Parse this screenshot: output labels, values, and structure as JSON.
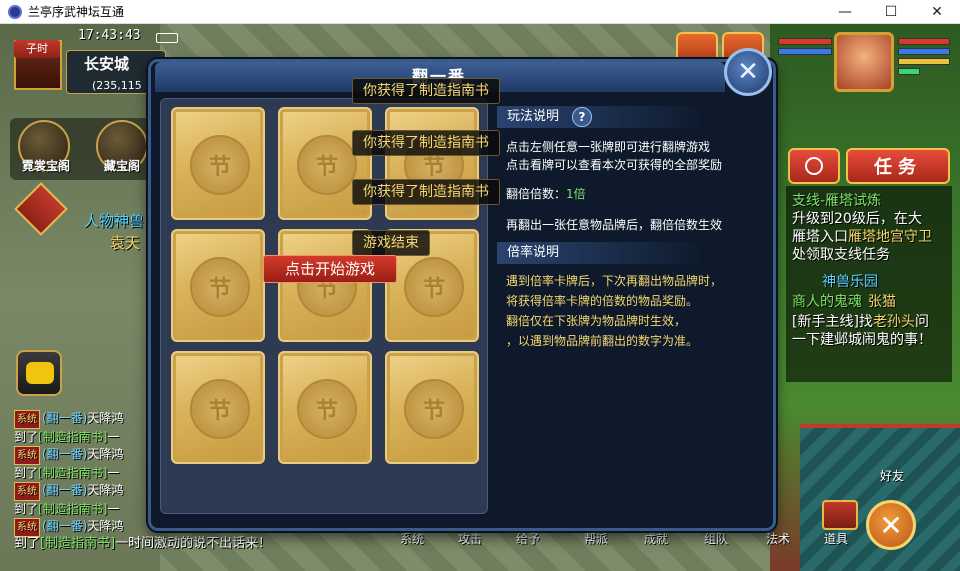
{
  "window": {
    "title": "兰亭序武神坛互通"
  },
  "hud": {
    "time_period": "子时",
    "clock": "17:43:43",
    "city": "长安城",
    "coords": "(235,115",
    "left_buttons": [
      "霓裳宝阁",
      "藏宝阁"
    ],
    "npc_name": "人物神兽",
    "npc_sub": "袁天"
  },
  "dialog": {
    "title": "翻一番",
    "card_glyph": "节",
    "start_button": "点击开始游戏",
    "popups": [
      "你获得了制造指南书",
      "你获得了制造指南书",
      "你获得了制造指南书",
      "游戏结束"
    ],
    "rules_header": "玩法说明",
    "help_mark": "?",
    "rules_lines": [
      "点击左侧任意一张牌即可进行翻牌游戏",
      "点击看牌可以查看本次可获得的全部奖励"
    ],
    "multiplier_label": "翻倍倍数：",
    "multiplier_value": "1倍",
    "reflip_hint": "再翻出一张任意物品牌后，翻倍倍数生效",
    "rate_header": "倍率说明",
    "rate_lines": [
      "遇到倍率卡牌后，下次再翻出物品牌时，",
      "将获得倍率卡牌的倍数的物品奖励。",
      "翻倍仅在下张牌为物品牌时生效，",
      "，以遇到物品牌前翻出的数字为准。"
    ]
  },
  "chat": {
    "tag": "系统",
    "lines": [
      {
        "a": "到了",
        "item": "[制造指南书]",
        "b": "一"
      },
      {
        "channel": "(翻一番)",
        "b": "天降鸿"
      },
      {
        "a": "到了",
        "item": "[制造指南书]",
        "b": "一"
      },
      {
        "channel": "(翻一番)",
        "b": "天降鸿"
      },
      {
        "a": "到了",
        "item": "[制造指南书]",
        "b": "一"
      },
      {
        "channel": "(翻一番)",
        "b": "天降鸿"
      }
    ],
    "last_prefix": "到了",
    "last_item": "[制造指南书]",
    "last_suffix": "一时间激动的说不出话来！"
  },
  "quests": {
    "task_button": "任务",
    "line1": "支线-雁塔试炼",
    "line2": "升级到20级后，在大",
    "line3a": "雁塔入口",
    "line3b": "雁塔地宫守卫",
    "line4": "处领取支线任务",
    "line5": "神兽乐园",
    "line6a": "商人的鬼魂",
    "line6b": "张猫",
    "line7a": "[新手主线]找",
    "line7b": "老孙头",
    "line7c": "问",
    "line8": "一下建邺城闹鬼的事！"
  },
  "bottom_menu": [
    "系统",
    "攻击",
    "给予",
    "帮派",
    "成就",
    "组队",
    "法术",
    "道具"
  ],
  "friend_label": "好友",
  "colors": {
    "gold_text": "#f5d76e",
    "green_text": "#7fe36a",
    "cyan_text": "#6fd3ff",
    "accent_red": "#c0392b"
  }
}
